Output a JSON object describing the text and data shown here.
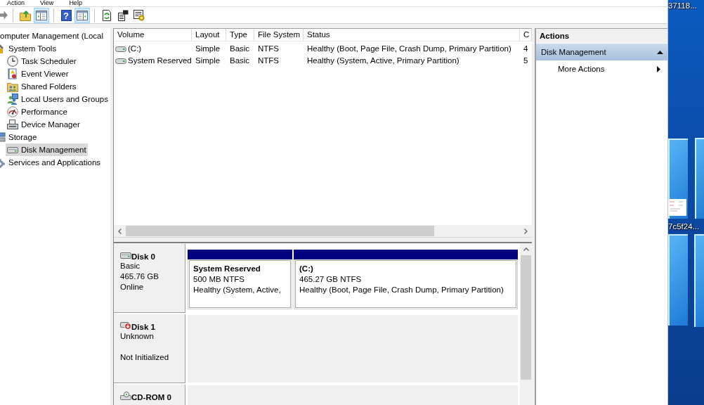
{
  "menu": [
    "Action",
    "View",
    "Help"
  ],
  "toolbar": {
    "groups": [
      [
        {
          "pressed": false
        }
      ],
      [
        {
          "pressed": false
        },
        {
          "pressed": true
        }
      ],
      [
        {
          "pressed": false,
          "glyph": "?"
        },
        {
          "pressed": true
        }
      ],
      [
        {
          "pressed": false
        },
        {
          "pressed": false
        },
        {
          "pressed": false
        }
      ]
    ]
  },
  "tree": {
    "items": [
      {
        "label": "omputer Management (Local",
        "selected": false,
        "children": [
          {
            "label": "System Tools",
            "selected": false,
            "children": [
              {
                "label": "Task Scheduler",
                "selected": false
              },
              {
                "label": "Event Viewer",
                "selected": false
              },
              {
                "label": "Shared Folders",
                "selected": false
              },
              {
                "label": "Local Users and Groups",
                "selected": false
              },
              {
                "label": "Performance",
                "selected": false
              },
              {
                "label": "Device Manager",
                "selected": false
              }
            ]
          },
          {
            "label": "Storage",
            "selected": false,
            "children": [
              {
                "label": "Disk Management",
                "selected": true
              }
            ]
          },
          {
            "label": "Services and Applications",
            "selected": false
          }
        ]
      }
    ]
  },
  "volume_list": {
    "columns": [
      "Volume",
      "Layout",
      "Type",
      "File System",
      "Status",
      "C"
    ],
    "rows": [
      [
        "(C:)",
        "Simple",
        "Basic",
        "NTFS",
        "Healthy (Boot, Page File, Crash Dump, Primary Partition)",
        "4"
      ],
      [
        "System Reserved",
        "Simple",
        "Basic",
        "NTFS",
        "Healthy (System, Active, Primary Partition)",
        "5"
      ]
    ]
  },
  "disk_map": {
    "disks": [
      {
        "kind": "disk",
        "name": "Disk 0",
        "type": "Basic",
        "size": "465.76 GB",
        "status": "Online",
        "partitions": [
          {
            "label": "System Reserved",
            "size": "500 MB NTFS",
            "status": "Healthy (System, Active,"
          },
          {
            "label": "(C:)",
            "size": "465.27 GB NTFS",
            "status": "Healthy (Boot, Page File, Crash Dump, Primary Partition)"
          }
        ]
      },
      {
        "kind": "uninitialized",
        "name": "Disk 1",
        "type": "Unknown",
        "status": "Not Initialized"
      },
      {
        "kind": "cdrom",
        "name": "CD-ROM 0"
      }
    ]
  },
  "actions": {
    "title": "Actions",
    "sections": [
      {
        "title": "Disk Management",
        "expanded": true,
        "items": [
          {
            "label": "More Actions",
            "submenu": true
          }
        ]
      }
    ]
  },
  "desktop": {
    "icons": [
      {
        "label": "37118..."
      },
      {
        "label": "7c5f24...",
        "thumbnail": true
      }
    ]
  }
}
